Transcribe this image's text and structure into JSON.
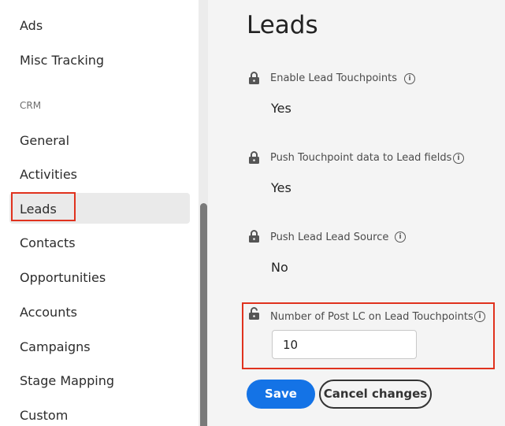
{
  "sidebar": {
    "items": [
      {
        "label": "Ads"
      },
      {
        "label": "Misc Tracking"
      },
      {
        "section": "CRM"
      },
      {
        "label": "General"
      },
      {
        "label": "Activities"
      },
      {
        "label": "Leads",
        "selected": true
      },
      {
        "label": "Contacts"
      },
      {
        "label": "Opportunities"
      },
      {
        "label": "Accounts"
      },
      {
        "label": "Campaigns"
      },
      {
        "label": "Stage Mapping"
      },
      {
        "label": "Custom"
      }
    ]
  },
  "main": {
    "title": "Leads",
    "settings": [
      {
        "label": "Enable Lead Touchpoints",
        "value": "Yes",
        "icon": "lock-icon"
      },
      {
        "label": "Push Touchpoint data to Lead fields",
        "value": "Yes",
        "icon": "lock-icon"
      },
      {
        "label": "Push Lead Lead Source",
        "value": "No",
        "icon": "lock-icon"
      },
      {
        "label": "Number of Post LC on Lead Touchpoints",
        "value": "10",
        "icon": "unlock-icon"
      }
    ],
    "save_label": "Save",
    "cancel_label": "Cancel changes"
  },
  "colors": {
    "accent": "#1473e6",
    "highlight": "#e0321e"
  }
}
